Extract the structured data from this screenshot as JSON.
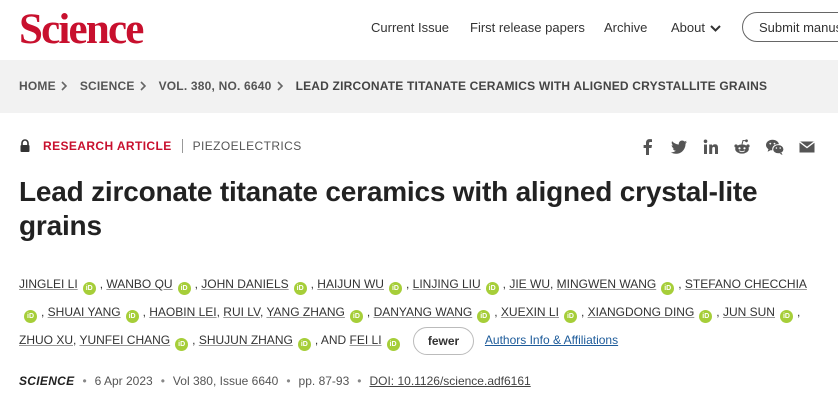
{
  "header": {
    "logo": "Science",
    "nav": {
      "current_issue": "Current Issue",
      "first_release": "First release papers",
      "archive": "Archive",
      "about": "About"
    },
    "submit_label": "Submit manuscript"
  },
  "breadcrumb": {
    "items": [
      "HOME",
      "SCIENCE",
      "VOL. 380, NO. 6640",
      "LEAD ZIRCONATE TITANATE CERAMICS WITH ALIGNED CRYSTALLITE GRAINS"
    ]
  },
  "article": {
    "type": "RESEARCH ARTICLE",
    "subject": "PIEZOELECTRICS",
    "title": "Lead zirconate titanate ceramics with aligned crystal-lite grains"
  },
  "share_icons": [
    "facebook-icon",
    "twitter-icon",
    "linkedin-icon",
    "reddit-icon",
    "wechat-icon",
    "email-icon"
  ],
  "authors": {
    "names": [
      "JINGLEI LI",
      "WANBO QU",
      "JOHN DANIELS",
      "HAIJUN WU",
      "LINJING LIU",
      "JIE WU",
      "MINGWEN WANG",
      "STEFANO CHECCHIA",
      "SHUAI YANG",
      "HAOBIN LEI",
      "RUI LV",
      "YANG ZHANG",
      "DANYANG WANG",
      "XUEXIN LI",
      "XIANGDONG DING",
      "JUN SUN",
      "ZHUO XU",
      "YUNFEI CHANG",
      "SHUJUN ZHANG",
      "FEI LI"
    ],
    "orcid_label": "iD",
    "and_text": ", AND",
    "fewer_label": "fewer",
    "affiliations_label": "Authors Info & Affiliations"
  },
  "citation": {
    "journal": "SCIENCE",
    "date": "6 Apr 2023",
    "volume": "Vol 380, Issue 6640",
    "pages": "pp. 87-93",
    "doi": "DOI: 10.1126/science.adf6161"
  },
  "colors": {
    "brand_red": "#c8102e",
    "orcid_green": "#a6ce39",
    "link_blue": "#1d5b9a",
    "crumb_bg": "#f2f2f2"
  }
}
